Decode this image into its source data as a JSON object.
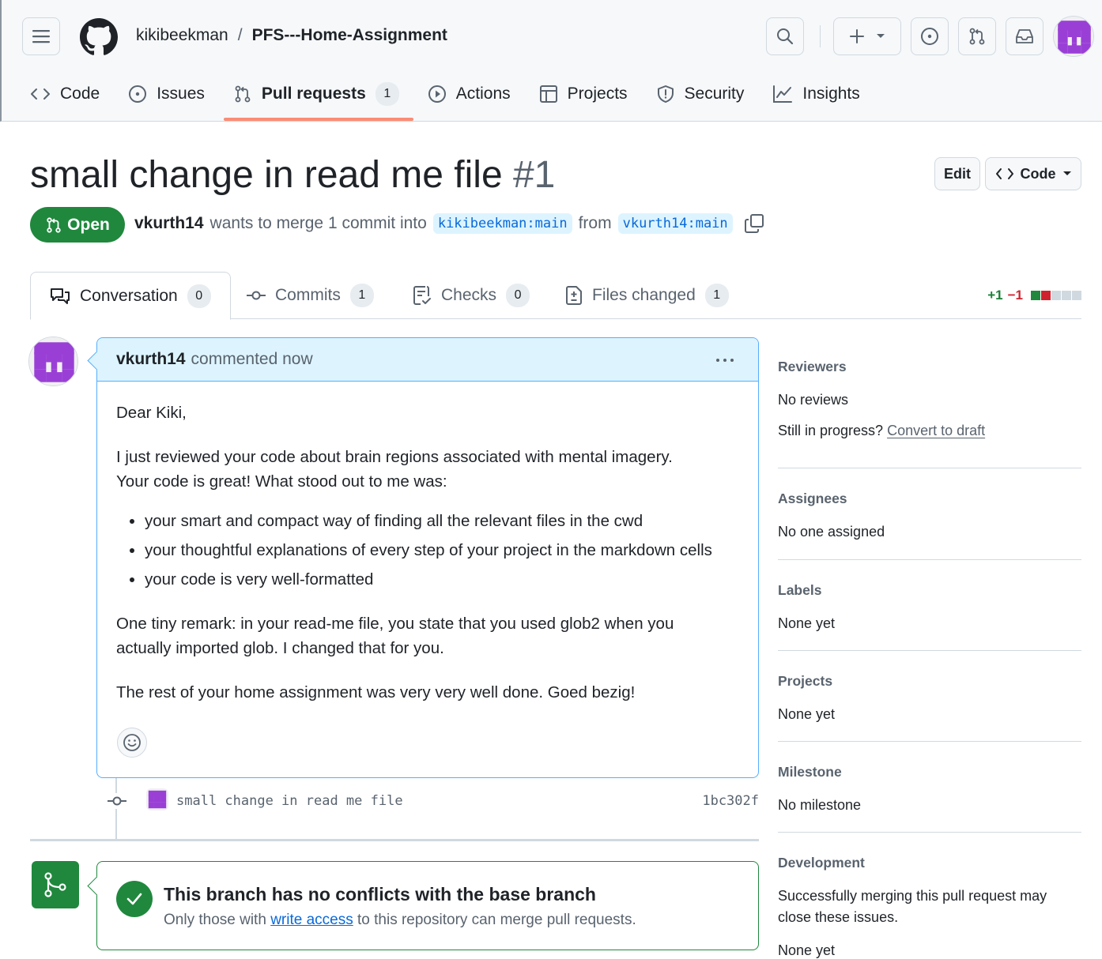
{
  "header": {
    "owner": "kikibeekman",
    "separator": "/",
    "repo": "PFS---Home-Assignment"
  },
  "nav": {
    "code": "Code",
    "issues": "Issues",
    "pull_requests": "Pull requests",
    "pull_requests_count": "1",
    "actions": "Actions",
    "projects": "Projects",
    "security": "Security",
    "insights": "Insights"
  },
  "pr": {
    "title": "small change in read me file",
    "number": "#1",
    "edit_label": "Edit",
    "code_label": "Code",
    "state": "Open",
    "author": "vkurth14",
    "merge_text": "wants to merge 1 commit into",
    "base_branch": "kikibeekman:main",
    "from_text": "from",
    "head_branch": "vkurth14:main"
  },
  "tabs": {
    "conversation": "Conversation",
    "conversation_count": "0",
    "commits": "Commits",
    "commits_count": "1",
    "checks": "Checks",
    "checks_count": "0",
    "files": "Files changed",
    "files_count": "1",
    "additions": "+1",
    "deletions": "−1"
  },
  "comment": {
    "author": "vkurth14",
    "timestamp": "commented now",
    "greeting": "Dear Kiki,",
    "para1_line1": "I just reviewed your code about brain regions associated with mental imagery.",
    "para1_line2": "Your code is great! What stood out to me was:",
    "bullets": [
      "your smart and compact way of finding all the relevant files in the cwd",
      "your thoughtful explanations of every step of your project in the markdown cells",
      "your code is very well-formatted"
    ],
    "para2": "One tiny remark: in your read-me file, you state that you used glob2 when you actually imported glob. I changed that for you.",
    "para3": "The rest of your home assignment was very very well done. Goed bezig!"
  },
  "commit": {
    "message": "small change in read me file",
    "sha": "1bc302f"
  },
  "merge": {
    "title": "This branch has no conflicts with the base branch",
    "sub_before": "Only those with",
    "sub_link": "write access",
    "sub_after": "to this repository can merge pull requests."
  },
  "sidebar": {
    "reviewers_label": "Reviewers",
    "reviewers_value": "No reviews",
    "draft_prompt": "Still in progress?",
    "draft_link": "Convert to draft",
    "assignees_label": "Assignees",
    "assignees_value": "No one assigned",
    "labels_label": "Labels",
    "labels_value": "None yet",
    "projects_label": "Projects",
    "projects_value": "None yet",
    "milestone_label": "Milestone",
    "milestone_value": "No milestone",
    "development_label": "Development",
    "development_text": "Successfully merging this pull request may close these issues.",
    "development_value": "None yet"
  },
  "colors": {
    "accent_open": "#1f883d",
    "link": "#0969da",
    "tab_underline": "#fd8c73",
    "avatar": "#9a3fd6"
  }
}
